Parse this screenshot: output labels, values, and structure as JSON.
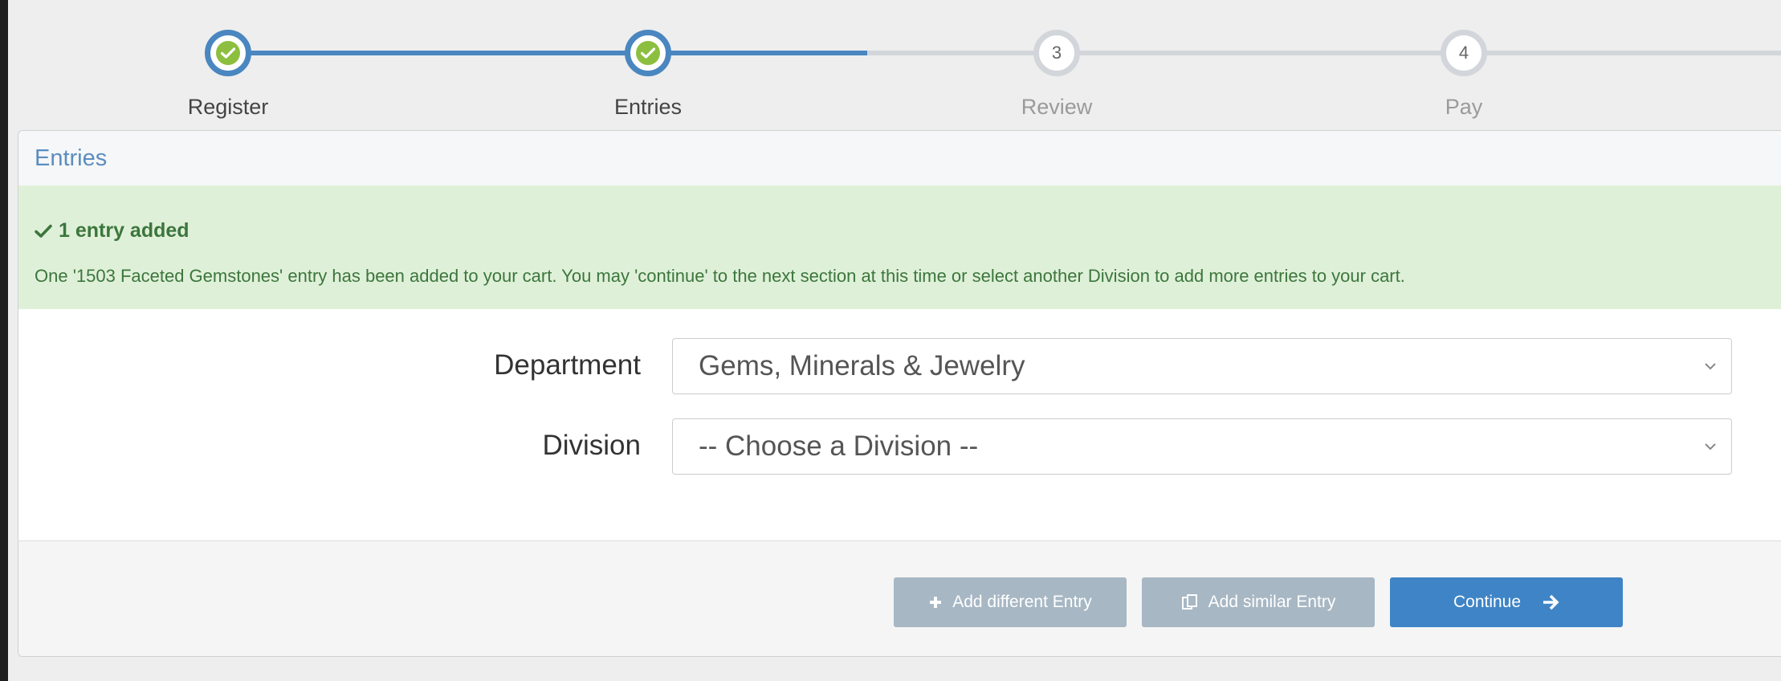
{
  "stepper": {
    "steps": [
      {
        "label": "Register",
        "state": "done",
        "number": "1"
      },
      {
        "label": "Entries",
        "state": "done",
        "number": "2"
      },
      {
        "label": "Review",
        "state": "todo",
        "number": "3"
      },
      {
        "label": "Pay",
        "state": "todo",
        "number": "4"
      }
    ]
  },
  "panel": {
    "title": "Entries"
  },
  "alert": {
    "title": "1 entry added",
    "message": "One '1503 Faceted Gemstones' entry has been added to your cart. You may 'continue' to the next section at this time or select another Division to add more entries to your cart."
  },
  "form": {
    "department_label": "Department",
    "department_value": "Gems, Minerals & Jewelry",
    "division_label": "Division",
    "division_value": "-- Choose a Division --"
  },
  "buttons": {
    "add_different": "Add different Entry",
    "add_similar": "Add similar Entry",
    "continue": "Continue"
  },
  "colors": {
    "accent": "#4a86c0",
    "success_bg": "#dff0d8",
    "success_text": "#3c763d",
    "check_green": "#8cbf3f",
    "button_primary": "#3f84c6",
    "button_disabled": "#a7b7c4"
  },
  "icons": [
    "check-icon",
    "plus-icon",
    "copy-icon",
    "arrow-right-icon",
    "chevron-down-icon"
  ]
}
